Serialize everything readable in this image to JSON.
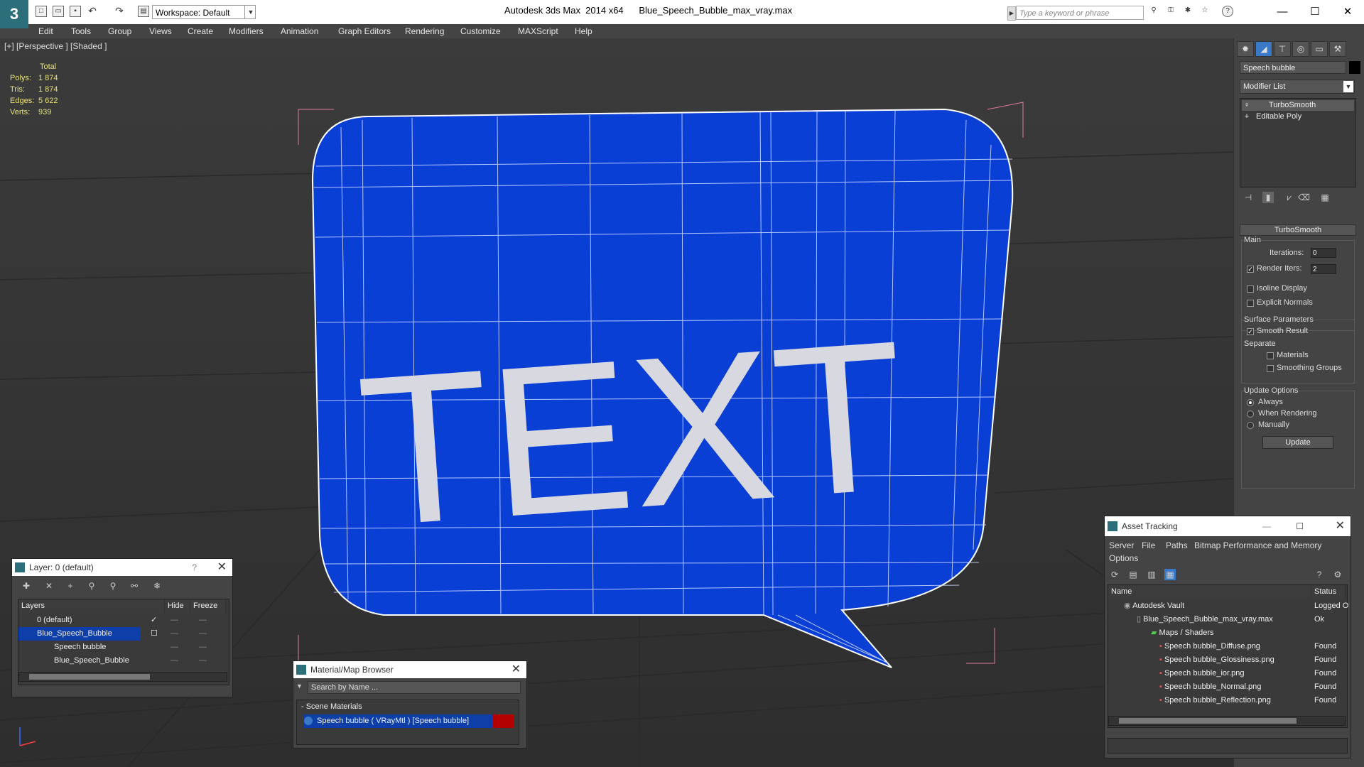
{
  "app": {
    "logo": "3",
    "title": "Autodesk 3ds Max  2014 x64      Blue_Speech_Bubble_max_vray.max",
    "workspace": "Workspace: Default",
    "search_placeholder": "Type a keyword or phrase"
  },
  "menu": [
    "Edit",
    "Tools",
    "Group",
    "Views",
    "Create",
    "Modifiers",
    "Animation",
    "Graph Editors",
    "Rendering",
    "Customize",
    "MAXScript",
    "Help"
  ],
  "viewport": {
    "label": "[+] [Perspective ] [Shaded ]",
    "model_text": "TEXT",
    "stats": {
      "header": "Total",
      "rows": [
        {
          "label": "Polys:",
          "value": "1 874"
        },
        {
          "label": "Tris:",
          "value": "1 874"
        },
        {
          "label": "Edges:",
          "value": "5 622"
        },
        {
          "label": "Verts:",
          "value": "939"
        }
      ]
    }
  },
  "command_panel": {
    "object_name": "Speech bubble",
    "modifier_list": "Modifier List",
    "stack": [
      "TurboSmooth",
      "Editable Poly"
    ],
    "turbosmooth": {
      "title": "TurboSmooth",
      "main": "Main",
      "iterations_label": "Iterations:",
      "iterations_value": "0",
      "render_iters_label": "Render Iters:",
      "render_iters_value": "2",
      "isoline": "Isoline Display",
      "explicit_normals": "Explicit Normals",
      "surface_params": "Surface Parameters",
      "smooth_result": "Smooth Result",
      "separate": "Separate",
      "materials": "Materials",
      "smoothing_groups": "Smoothing Groups",
      "update_options": "Update Options",
      "always": "Always",
      "when_rendering": "When Rendering",
      "manually": "Manually",
      "update_btn": "Update"
    }
  },
  "layer_window": {
    "title": "Layer: 0 (default)",
    "help": "?",
    "columns": [
      "Layers",
      "Hide",
      "Freeze"
    ],
    "rows": [
      "0 (default)",
      "Blue_Speech_Bubble",
      "Speech bubble",
      "Blue_Speech_Bubble"
    ]
  },
  "material_browser": {
    "title": "Material/Map Browser",
    "search_placeholder": "Search by Name ...",
    "section": "- Scene Materials",
    "item": "Speech bubble  ( VRayMtl )  [Speech bubble]"
  },
  "asset_tracking": {
    "title": "Asset Tracking",
    "menu": [
      "Server",
      "File",
      "Paths",
      "Bitmap Performance and Memory"
    ],
    "menu2": "Options",
    "columns": [
      "Name",
      "Status"
    ],
    "rows": [
      {
        "name": "Autodesk Vault",
        "status": "Logged O"
      },
      {
        "name": "Blue_Speech_Bubble_max_vray.max",
        "status": "Ok"
      },
      {
        "name": "Maps / Shaders",
        "status": ""
      },
      {
        "name": "Speech bubble_Diffuse.png",
        "status": "Found"
      },
      {
        "name": "Speech bubble_Glossiness.png",
        "status": "Found"
      },
      {
        "name": "Speech bubble_ior.png",
        "status": "Found"
      },
      {
        "name": "Speech bubble_Normal.png",
        "status": "Found"
      },
      {
        "name": "Speech bubble_Reflection.png",
        "status": "Found"
      }
    ]
  },
  "colors": {
    "bubble_blue": "#0a3fd6",
    "selection_blue": "#0e3ea8",
    "stats_yellow": "#e8e27a",
    "material_red": "#b30000"
  }
}
